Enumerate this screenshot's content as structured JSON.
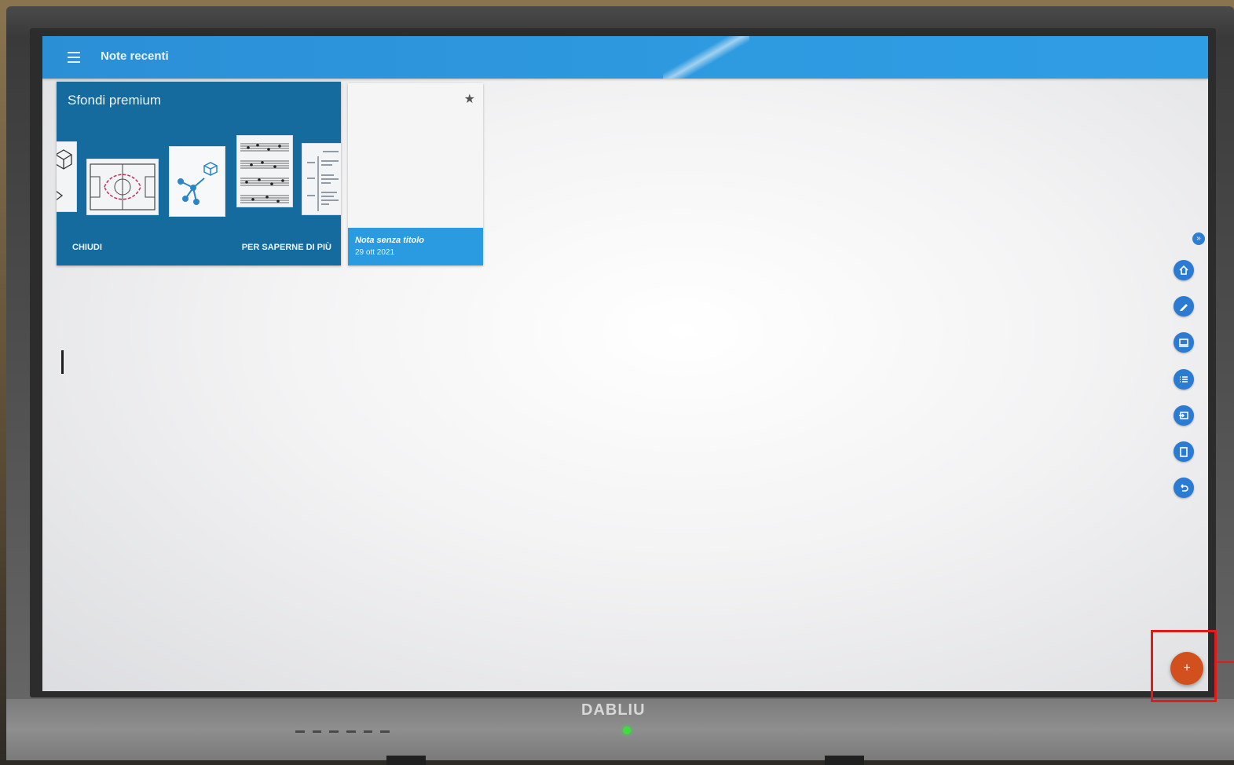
{
  "appbar": {
    "title": "Note recenti"
  },
  "premium_card": {
    "title": "Sfondi premium",
    "close_label": "CHIUDI",
    "more_label": "PER SAPERNE DI PIÙ"
  },
  "notes": [
    {
      "title": "Nota senza titolo",
      "date": "29 ott 2021"
    }
  ],
  "monitor": {
    "brand": "DABLIU"
  },
  "toolbar": {
    "collapse_glyph": "»",
    "items": [
      {
        "icon": "home-icon"
      },
      {
        "icon": "pen-icon"
      },
      {
        "icon": "screen-icon"
      },
      {
        "icon": "list-icon"
      },
      {
        "icon": "input-source-icon"
      },
      {
        "icon": "clipboard-icon"
      },
      {
        "icon": "undo-back-icon"
      }
    ]
  },
  "fab": {
    "label": "+"
  },
  "colors": {
    "appbar": "#2e9ae0",
    "premium_card": "#166b9e",
    "note_footer": "#2b9be1",
    "tool_button": "#2b7bd3",
    "fab": "#d1501e",
    "highlight": "#e31a1a"
  }
}
